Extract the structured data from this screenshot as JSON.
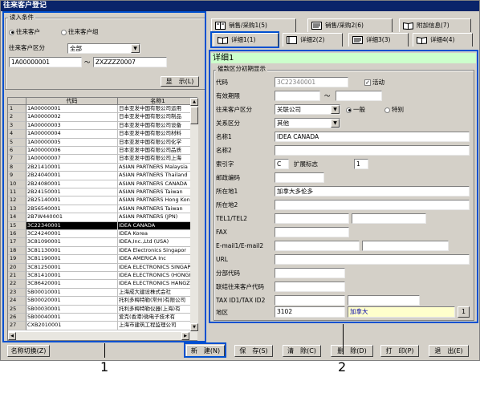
{
  "window": {
    "title": "往来客户登记"
  },
  "left": {
    "group_title": "读入条件",
    "radio_customer": "往来客户",
    "radio_group": "往来客户组",
    "category_label": "往来客户区分",
    "category_value": "全部",
    "range_from": "1A00000001",
    "range_sep": "～",
    "range_to": "ZXZZZZ0007",
    "show_button": "显　示(L)",
    "grid": {
      "col_code": "代码",
      "col_name": "名称1",
      "rows": [
        {
          "n": "1",
          "code": "1A00000001",
          "name": "日本亚发中国有限公司运用"
        },
        {
          "n": "2",
          "code": "1A00000002",
          "name": "日本亚发中国有限公司制品"
        },
        {
          "n": "3",
          "code": "1A00000003",
          "name": "日本亚发中国有限公司设备"
        },
        {
          "n": "4",
          "code": "1A00000004",
          "name": "日本亚发中国有限公司材料"
        },
        {
          "n": "5",
          "code": "1A00000005",
          "name": "日本亚发中国有限公司化学"
        },
        {
          "n": "6",
          "code": "1A00000006",
          "name": "日本亚发中国有限公司品质"
        },
        {
          "n": "7",
          "code": "1A00000007",
          "name": "日本亚发中国有限公司上海"
        },
        {
          "n": "8",
          "code": "2B21410001",
          "name": "ASIAN PARTNERS Malaysia"
        },
        {
          "n": "9",
          "code": "2B24040001",
          "name": "ASIAN PARTNERS Thailand"
        },
        {
          "n": "10",
          "code": "2B24080001",
          "name": "ASIAN PARTNERS CANADA"
        },
        {
          "n": "11",
          "code": "2B24150001",
          "name": "ASIAN PARTNERS Taiwan"
        },
        {
          "n": "12",
          "code": "2B25140001",
          "name": "ASIAN PARTNERS Hong Kong"
        },
        {
          "n": "13",
          "code": "2B56540001",
          "name": "ASIAN PARTNERS Taiwan"
        },
        {
          "n": "14",
          "code": "2B7W440001",
          "name": "ASIAN PARTNERS (JPN)"
        },
        {
          "n": "15",
          "code": "3C22340001",
          "name": "IDEA CANADA"
        },
        {
          "n": "16",
          "code": "3C24240001",
          "name": "IDEA Korea"
        },
        {
          "n": "17",
          "code": "3C81090001",
          "name": "IDEA,Inc.,Ltd (USA)"
        },
        {
          "n": "18",
          "code": "3C81130001",
          "name": "IDEA Electronics Singapor"
        },
        {
          "n": "19",
          "code": "3C81190001",
          "name": "IDEA AMERICA Inc"
        },
        {
          "n": "20",
          "code": "3C81250001",
          "name": "IDEA ELECTRONICS SINGAPOR"
        },
        {
          "n": "21",
          "code": "3C81410001",
          "name": "IDEA ELECTRONICS (HONGKON"
        },
        {
          "n": "22",
          "code": "3C86420001",
          "name": "IDEA ELECTRONICS HANGZHOU"
        },
        {
          "n": "23",
          "code": "5B00010001",
          "name": "上海成大建设株式会社"
        },
        {
          "n": "24",
          "code": "5B00020001",
          "name": "托利多梅特勒(常州)有限公司"
        },
        {
          "n": "25",
          "code": "5B00030001",
          "name": "托利多梅特勒仪器(上海)有"
        },
        {
          "n": "26",
          "code": "5B00040001",
          "name": "爱克(香港)微电子技术有"
        },
        {
          "n": "27",
          "code": "CXB2010001",
          "name": "上海市建筑工程监理公司"
        }
      ],
      "selected_row": 15
    },
    "name_switch_button": "名称切换(Z)"
  },
  "tabs_row1": [
    {
      "label": "销售/采购1(5)"
    },
    {
      "label": "销售/采购2(6)"
    },
    {
      "label": "附加信息(7)"
    }
  ],
  "tabs_row2": [
    {
      "label": "详细1(1)"
    },
    {
      "label": "详细2(2)"
    },
    {
      "label": "详细3(3)"
    },
    {
      "label": "详细4(4)"
    }
  ],
  "detail": {
    "header": "详细1",
    "group_title": "催款区分初期显示",
    "code_label": "代码",
    "code_value": "3C22340001",
    "active_label": "活动",
    "period_label": "有效期限",
    "period_sep": "～",
    "category_label": "往来客户区分",
    "category_value": "关联公司",
    "radio_general": "一般",
    "radio_special": "特别",
    "relation_label": "关系区分",
    "relation_value": "其他",
    "name1_label": "名称1",
    "name1_value": "IDEA CANADA",
    "name2_label": "名称2",
    "index_label": "索引字",
    "index_value": "C",
    "ext_label": "扩展标志",
    "ext_value": "1",
    "zip_label": "邮政编码",
    "addr1_label": "所在地1",
    "addr1_value": "加拿大多伦多",
    "addr2_label": "所在地2",
    "tel_label": "TEL1/TEL2",
    "fax_label": "FAX",
    "email_label": "E-mail1/E-mail2",
    "url_label": "URL",
    "branch_label": "分部代码",
    "link_label": "联结往来客户代码",
    "tax_label": "TAX ID1/TAX ID2",
    "region_label": "地区",
    "region_code": "3102",
    "region_name": "加拿大",
    "region_btn": "1"
  },
  "buttons": {
    "new": "新　建(N)",
    "save": "保　存(S)",
    "clear": "清　除(C)",
    "delete": "删　除(D)",
    "print": "打　印(P)",
    "exit": "退　出(E)"
  },
  "callouts": {
    "one": "1",
    "two": "2"
  }
}
